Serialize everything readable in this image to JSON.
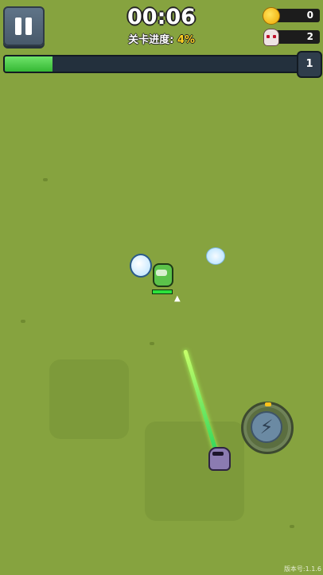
{
  "hud": {
    "timer": "00:06",
    "progress_label": "关卡进度:",
    "progress_value": "4%",
    "coins": "0",
    "kills": "2",
    "level": "1",
    "xp_fraction": 0.16
  },
  "icons": {
    "pause": "pause-icon",
    "coin": "coin-icon",
    "skull": "skull-icon",
    "skill": "lightning-icon"
  },
  "colors": {
    "grass": "#86a33f",
    "xp_fill": "#35b834",
    "progress_highlight": "#ffd21f"
  },
  "footer": {
    "version": "版本号:1.1.6"
  }
}
